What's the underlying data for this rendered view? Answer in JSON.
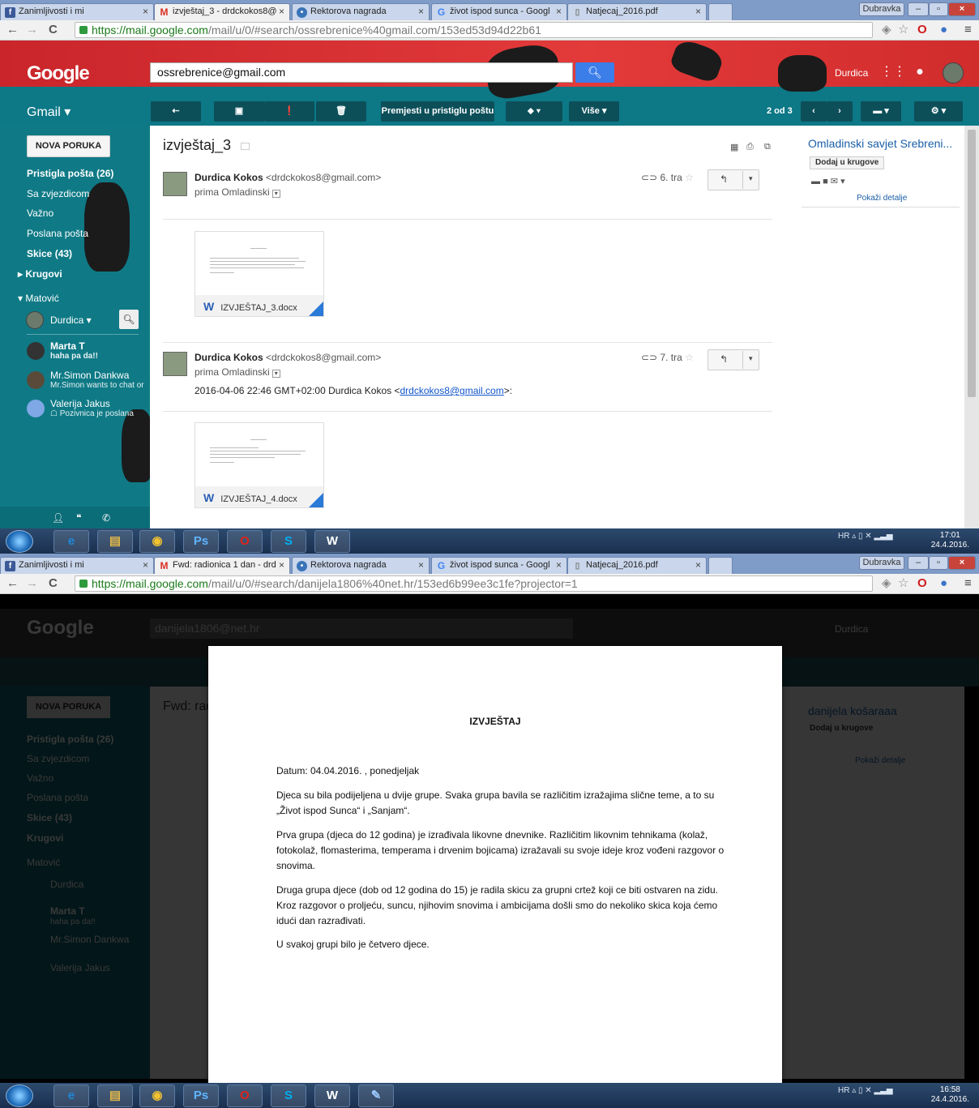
{
  "windows": [
    {
      "tabs": [
        {
          "label": "Zanimljivosti i mi",
          "icon": "f",
          "color": "#3b5998"
        },
        {
          "label": "izvještaj_3 - drdckokos8@",
          "icon": "M",
          "color": "#d93025"
        },
        {
          "label": "Rektorova nagrada",
          "icon": "•",
          "color": "#3a74b8"
        },
        {
          "label": "život ispod sunca - Googl",
          "icon": "G",
          "color": "#4285f4"
        },
        {
          "label": "Natjecaj_2016.pdf",
          "icon": "▯",
          "color": "#777777"
        }
      ],
      "window_user": "Dubravka",
      "url_host": "https://mail.google.com",
      "url_path": "/mail/u/0/#search/ossrebrenice%40gmail.com/153ed53d94d22b61",
      "search_value": "ossrebrenice@gmail.com",
      "user_name": "Durdica",
      "toolbar": {
        "move_label": "Premjesti u pristiglu poštu",
        "more_label": "Više ▾",
        "count": "2 od 3"
      },
      "gmail_label": "Gmail ▾",
      "compose": "NOVA PORUKA",
      "sidebar": [
        {
          "label": "Pristigla pošta (26)",
          "bold": true
        },
        {
          "label": "Sa zvjezdicom",
          "bold": false
        },
        {
          "label": "Važno",
          "bold": false
        },
        {
          "label": "Poslana pošta",
          "bold": false
        },
        {
          "label": "Skice (43)",
          "bold": true
        },
        {
          "label": "▸ Krugovi",
          "bold": true
        },
        {
          "label": "▾ Matović",
          "bold": false
        }
      ],
      "chat_user": "Durdica ▾",
      "contacts": [
        {
          "name": "Marta T",
          "status": "haha pa da!!"
        },
        {
          "name": "Mr.Simon Dankwa",
          "status": "Mr.Simon wants to chat or"
        },
        {
          "name": "Valerija Jakus",
          "status": "☖ Pozivnica je poslana"
        }
      ],
      "subject": "izvještaj_3",
      "messages": [
        {
          "sender": "Durdica Kokos",
          "email": "<drdckokos8@gmail.com>",
          "to": "prima Omladinski",
          "date": "6. tra",
          "body_prefix": "",
          "body_link": "",
          "body_suffix": "",
          "attachment": "IZVJEŠTAJ_3.docx"
        },
        {
          "sender": "Durdica Kokos",
          "email": "<drdckokos8@gmail.com>",
          "to": "prima Omladinski",
          "date": "7. tra",
          "body_prefix": "2016-04-06 22:46 GMT+02:00 Durdica Kokos <",
          "body_link": "drdckokos8@gmail.com",
          "body_suffix": ">:",
          "attachment": "IZVJEŠTAJ_4.docx"
        }
      ],
      "contact_card": {
        "name": "Omladinski savjet Srebreni...",
        "circles": "Dodaj u krugove",
        "details": "Pokaži detalje"
      },
      "taskbar": {
        "lang": "HR",
        "time": "17:01",
        "date": "24.4.2016."
      }
    },
    {
      "tabs": [
        {
          "label": "Zanimljivosti i mi",
          "icon": "f",
          "color": "#3b5998"
        },
        {
          "label": "Fwd: radionica 1 dan - drd",
          "icon": "M",
          "color": "#d93025"
        },
        {
          "label": "Rektorova nagrada",
          "icon": "•",
          "color": "#3a74b8"
        },
        {
          "label": "život ispod sunca - Googl",
          "icon": "G",
          "color": "#4285f4"
        },
        {
          "label": "Natjecaj_2016.pdf",
          "icon": "▯",
          "color": "#777777"
        }
      ],
      "window_user": "Dubravka",
      "url_host": "https://mail.google.com",
      "url_path": "/mail/u/0/#search/danijela1806%40net.hr/153ed6b99ee3c1fe?projector=1",
      "background": {
        "search_value": "danijela1806@net.hr",
        "user_name": "Durdica",
        "subject": "Fwd: rad",
        "contact_name": "danijela košaraaa",
        "circles": "Dodaj u krugove",
        "details": "Pokaži detalje",
        "sidebar": [
          "NOVA PORUKA",
          "Pristigla pošta (26)",
          "Sa zvjezdicom",
          "Važno",
          "Poslana pošta",
          "Skice (43)",
          "Krugovi",
          "Matović",
          "Durdica",
          "Marta T",
          "haha pa da!!",
          "Mr.Simon Dankwa",
          "Valerija Jakus"
        ]
      },
      "document": {
        "title": "IZVJEŠTAJ",
        "paragraphs": [
          "Datum: 04.04.2016. , ponedjeljak",
          "Djeca su bila podijeljena u dvije grupe. Svaka grupa bavila se različitim izražajima slične teme, a to su „Život ispod Sunca“ i „Sanjam“.",
          "Prva grupa (djeca do 12 godina) je izrađivala likovne dnevnike. Različitim likovnim tehnikama (kolaž, fotokolaž, flomasterima, temperama i drvenim bojicama) izražavali su svoje ideje kroz vođeni razgovor o snovima.",
          "Druga grupa djece (dob od 12 godina do 15) je radila skicu za grupni crtež koji ce biti ostvaren na zidu. Kroz razgovor o proljeću, suncu, njihovim snovima i ambicijama došli smo do nekoliko skica koja ćemo idući dan razrađivati.",
          "U svakoj grupi bilo je četvero djece."
        ]
      },
      "taskbar": {
        "lang": "HR",
        "time": "16:58",
        "date": "24.4.2016."
      }
    }
  ],
  "colors": {
    "gmail_teal": "#0f7a86",
    "header_red": "#d8312f",
    "search_blue": "#3b7de9",
    "link": "#1155cc"
  }
}
